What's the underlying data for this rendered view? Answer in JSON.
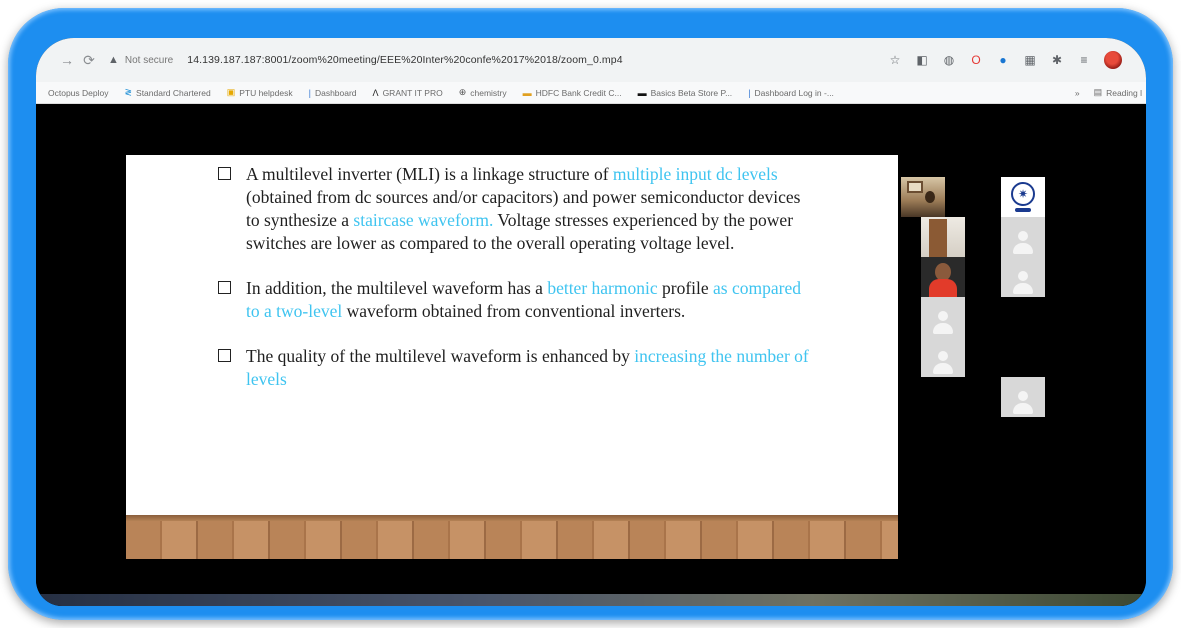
{
  "browser": {
    "not_secure_label": "Not secure",
    "url": "14.139.187.187:8001/zoom%20meeting/EEE%20Inter%20confe%2017%2018/zoom_0.mp4"
  },
  "bookmarks": [
    {
      "label": "Octopus Deploy",
      "icon": "octopus-icon"
    },
    {
      "label": "Standard Chartered",
      "icon": "standard-chartered-icon"
    },
    {
      "label": "PTU helpdesk",
      "icon": "helpdesk-icon"
    },
    {
      "label": "Dashboard",
      "icon": "dashboard-icon"
    },
    {
      "label": "GRANT IT PRO",
      "icon": "grant-icon"
    },
    {
      "label": "chemistry",
      "icon": "globe-icon"
    },
    {
      "label": "HDFC Bank Credit C...",
      "icon": "hdfc-icon"
    },
    {
      "label": "Basics Beta Store P...",
      "icon": "store-icon"
    },
    {
      "label": "Dashboard Log in -...",
      "icon": "login-icon"
    }
  ],
  "bookmarks_more": "»",
  "reading_list_label": "Reading l",
  "slide": {
    "bullets": [
      {
        "parts": [
          {
            "text": "A multilevel inverter (MLI) is a linkage structure of ",
            "hl": false
          },
          {
            "text": "multiple input dc levels",
            "hl": true
          },
          {
            "text": " (obtained from dc sources and/or capacitors) and power semiconductor devices to synthesize a ",
            "hl": false
          },
          {
            "text": "staircase waveform.",
            "hl": true
          },
          {
            "text": " Voltage stresses experienced by the power switches are lower as compared to the overall operating voltage level.",
            "hl": false
          }
        ]
      },
      {
        "parts": [
          {
            "text": "In addition, the multilevel waveform has a ",
            "hl": false
          },
          {
            "text": "better harmonic",
            "hl": true
          },
          {
            "text": " profile ",
            "hl": false
          },
          {
            "text": "as compared to a two-level",
            "hl": true
          },
          {
            "text": " waveform obtained from conventional inverters.",
            "hl": false
          }
        ]
      },
      {
        "parts": [
          {
            "text": "The quality of the multilevel waveform is enhanced by ",
            "hl": false
          },
          {
            "text": "increasing the number of levels",
            "hl": true
          }
        ]
      }
    ]
  },
  "colors": {
    "frame": "#1d8ef0",
    "highlight": "#3fc4f0"
  }
}
